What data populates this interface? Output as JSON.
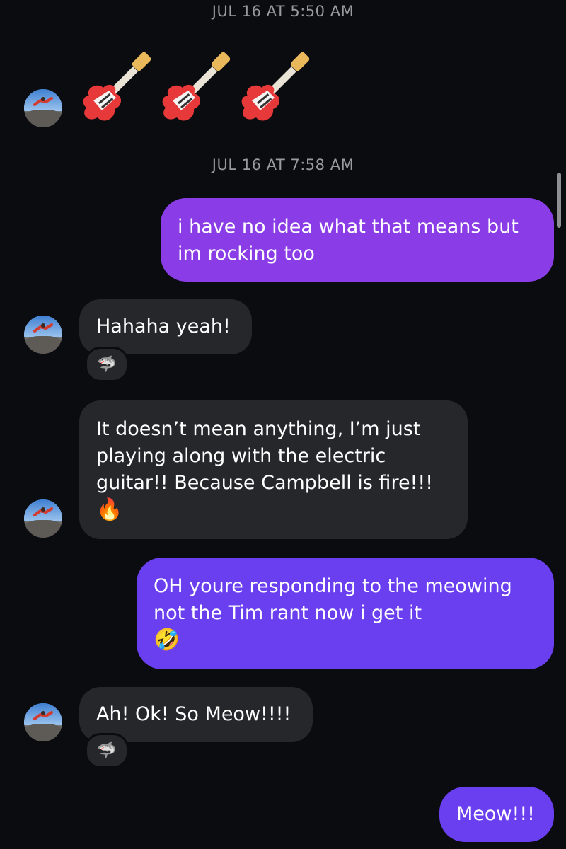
{
  "timestamps": [
    "JUL 16 AT 5:50 AM",
    "JUL 16 AT 7:58 AM"
  ],
  "messages": [
    {
      "sender": "them",
      "text": "🎸🎸🎸"
    },
    {
      "sender": "me",
      "text": "i have no idea what that means but im rocking too"
    },
    {
      "sender": "them",
      "text": "Hahaha yeah!",
      "reaction": "🦈"
    },
    {
      "sender": "them",
      "text": "It doesn’t mean anything, I’m just playing along with the electric guitar!! Because Campbell is fire!!!",
      "emoji": "🔥"
    },
    {
      "sender": "me",
      "text": "OH youre responding to the meowing not the Tim rant now i get it",
      "emoji": "🤣"
    },
    {
      "sender": "them",
      "text": "Ah! Ok! So Meow!!!!",
      "reaction": "🦈"
    },
    {
      "sender": "me",
      "text": "Meow!!!"
    }
  ],
  "colors": {
    "background": "#0b0c10",
    "incoming_bubble": "#26272b",
    "outgoing_bubble_top": "#8a3de6",
    "outgoing_bubble_bottom": "#6a3ff0",
    "timestamp": "#9a9ba0"
  },
  "icons": [
    "guitar-icon",
    "shark-icon",
    "fire-icon",
    "rolling-laughing-icon",
    "avatar"
  ]
}
